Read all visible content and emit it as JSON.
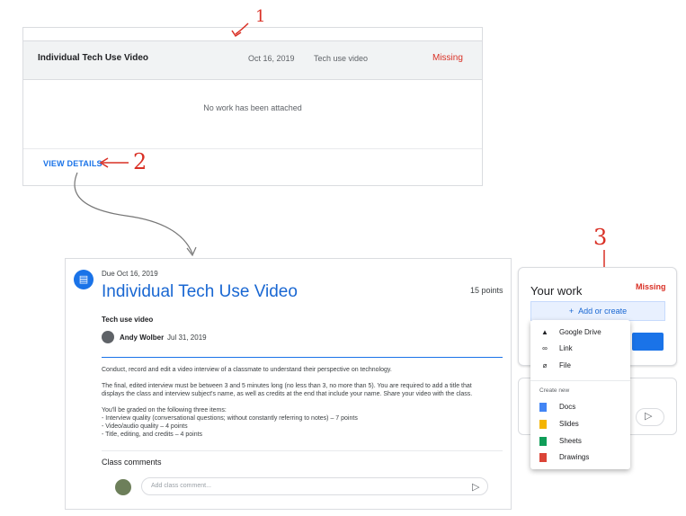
{
  "assignment_row": {
    "name": "Individual Tech Use Video",
    "date": "Oct 16, 2019",
    "type": "Tech use video",
    "status": "Missing"
  },
  "no_work_text": "No work has been attached",
  "view_details_label": "VIEW DETAILS",
  "annotations": [
    "1",
    "2",
    "3"
  ],
  "detail": {
    "due": "Due Oct 16, 2019",
    "title": "Individual Tech Use Video",
    "points": "15 points",
    "subtitle": "Tech use video",
    "author": "Andy Wolber",
    "author_date": "Jul 31, 2019",
    "desc1": "Conduct, record and edit a video interview of a classmate to understand their perspective on technology.",
    "desc2a": "The final, edited interview must be between 3 and 5 minutes long (no less than 3, no more than 5). You are required to add a title that",
    "desc2b": "displays the class and interview subject's name, as well as credits at the end that include your name. Share your video with the class.",
    "desc3": "You'll be graded on the following three items:",
    "desc4": "- Interview quality (conversational questions; without constantly referring to notes) – 7 points",
    "desc5": "- Video/audio quality – 4 points",
    "desc6": "- Title, editing, and credits – 4 points",
    "comments_label": "Class comments",
    "comment_placeholder": "Add class comment..."
  },
  "work_panel": {
    "title": "Your work",
    "status": "Missing",
    "add_create": "Add or create"
  },
  "menu": {
    "items": [
      {
        "label": "Google Drive",
        "icon": "drive-icon"
      },
      {
        "label": "Link",
        "icon": "link-icon"
      },
      {
        "label": "File",
        "icon": "paperclip-icon"
      }
    ],
    "create_new_label": "Create new",
    "create_items": [
      {
        "label": "Docs",
        "color": "#4285f4"
      },
      {
        "label": "Slides",
        "color": "#f4b400"
      },
      {
        "label": "Sheets",
        "color": "#0f9d58"
      },
      {
        "label": "Drawings",
        "color": "#db4437"
      }
    ]
  }
}
